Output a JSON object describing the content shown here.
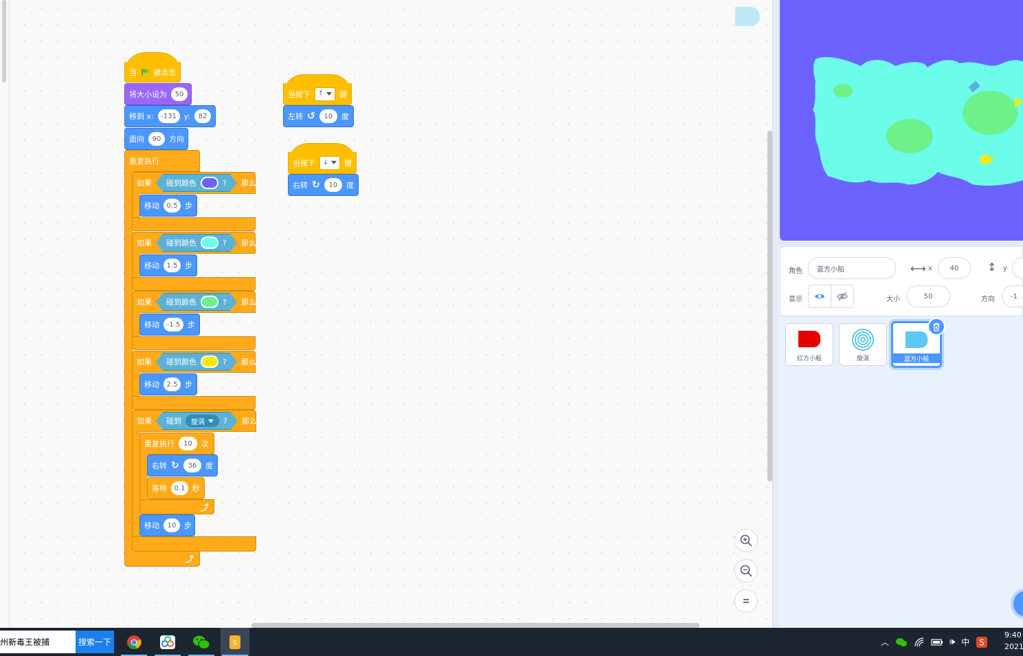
{
  "scripts": {
    "green_flag": {
      "hat_when": "当",
      "hat_clicked": "被点击",
      "set_size_label": "将大小设为",
      "set_size_value": "50",
      "goto_label": "移到 x:",
      "goto_x": "-131",
      "goto_y_label": "y:",
      "goto_y": "82",
      "point_label": "面向",
      "point_value": "90",
      "point_suffix": "方向",
      "forever_label": "重复执行",
      "if_blocks": [
        {
          "if": "如果",
          "sense": "碰到颜色",
          "q": "?",
          "then": "那么",
          "color": "#6c63ff",
          "move": "移动",
          "steps": "0.5",
          "unit": "步"
        },
        {
          "if": "如果",
          "sense": "碰到颜色",
          "q": "?",
          "then": "那么",
          "color": "#6cfcea",
          "move": "移动",
          "steps": "1.5",
          "unit": "步"
        },
        {
          "if": "如果",
          "sense": "碰到颜色",
          "q": "?",
          "then": "那么",
          "color": "#6ef08a",
          "move": "移动",
          "steps": "-1.5",
          "unit": "步"
        },
        {
          "if": "如果",
          "sense": "碰到颜色",
          "q": "?",
          "then": "那么",
          "color": "#ffea00",
          "move": "移动",
          "steps": "2.5",
          "unit": "步"
        }
      ],
      "touch_if": {
        "if": "如果",
        "sense": "碰到",
        "target": "旋涡",
        "q": "?",
        "then": "那么",
        "repeat_label": "重复执行",
        "repeat_times": "10",
        "repeat_unit": "次",
        "turn_label": "右转",
        "turn_value": "36",
        "turn_unit": "度",
        "wait_label": "等待",
        "wait_value": "0.1",
        "wait_unit": "秒",
        "move_label": "移动",
        "move_value": "10",
        "move_unit": "步"
      }
    },
    "up_key": {
      "hat_label": "当按下",
      "key": "↑",
      "hat_suffix": "键",
      "turn_label": "左转",
      "turn_value": "10",
      "turn_unit": "度"
    },
    "down_key": {
      "hat_label": "当按下",
      "key": "↓",
      "hat_suffix": "键",
      "turn_label": "右转",
      "turn_value": "10",
      "turn_unit": "度"
    }
  },
  "sprite_info": {
    "sprite_label": "角色",
    "sprite_name": "蓝方小船",
    "x_label": "x",
    "x_value": "40",
    "y_label": "y",
    "show_label": "显示",
    "size_label": "大小",
    "size_value": "50",
    "direction_label": "方向",
    "direction_value": "-1"
  },
  "sprites": [
    {
      "name": "红方小船",
      "color": "#e60000"
    },
    {
      "name": "旋涡",
      "color": "#5cc8e8"
    },
    {
      "name": "蓝方小船",
      "color": "#5cc8f5"
    }
  ],
  "taskbar": {
    "search_text": "州新毒王被捕",
    "search_button": "搜索一下",
    "ime": "中",
    "time": "9:40",
    "date": "2021"
  },
  "colors": {
    "stage_bg": "#6c63ff",
    "island": "#6cfcea",
    "green_patch": "#6ef08a",
    "event": "#ffbf00",
    "control": "#ffab19",
    "motion": "#4c97ff",
    "looks": "#9966ff",
    "sensing": "#5cb1d6"
  }
}
